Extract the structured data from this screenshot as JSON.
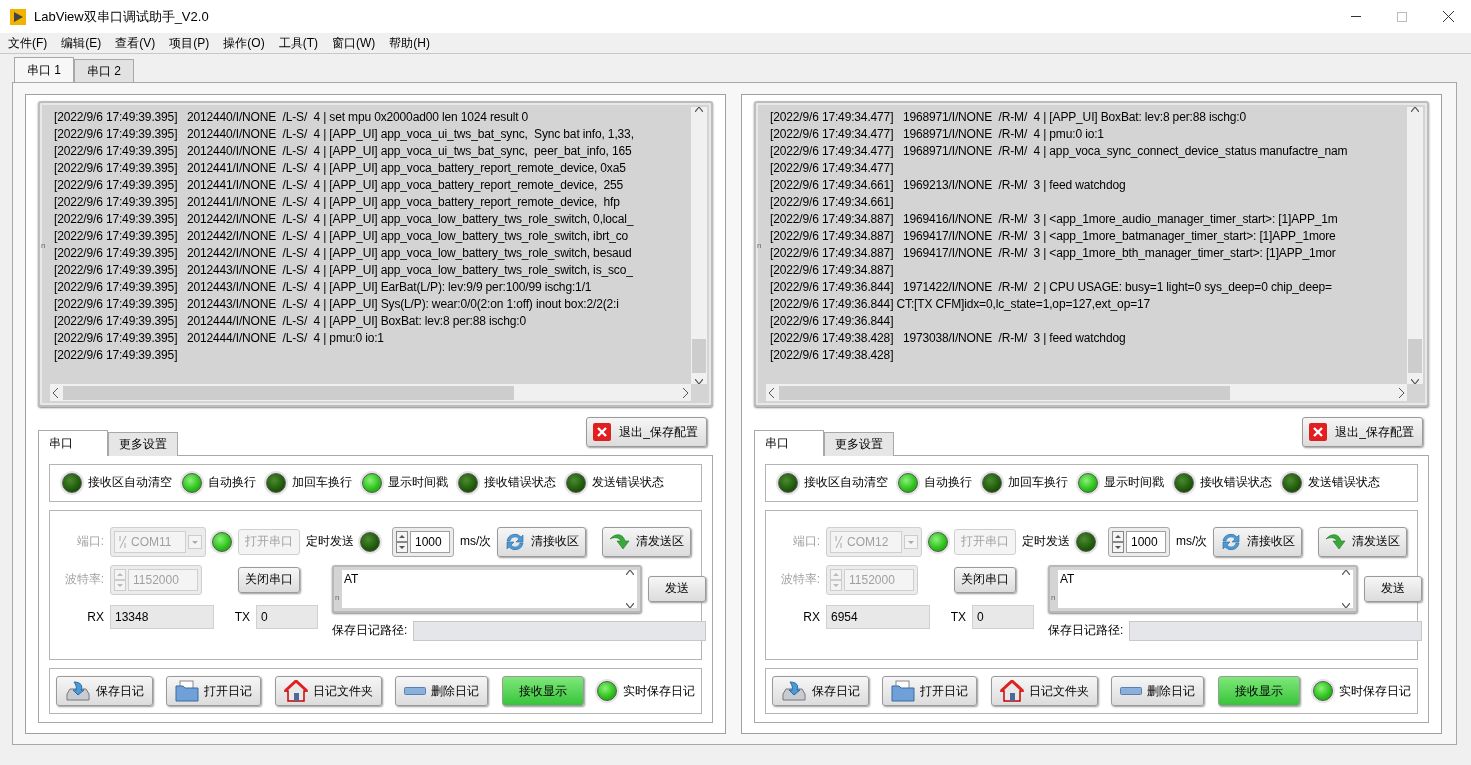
{
  "window": {
    "title": "LabView双串口调试助手_V2.0"
  },
  "menu": [
    "文件(F)",
    "编辑(E)",
    "查看(V)",
    "项目(P)",
    "操作(O)",
    "工具(T)",
    "窗口(W)",
    "帮助(H)"
  ],
  "tabs": [
    {
      "label": "串口 1",
      "selected": true
    },
    {
      "label": "串口 2",
      "selected": false
    }
  ],
  "panels": [
    {
      "log_marker": "n",
      "log": [
        "[2022/9/6 17:49:39.395]   2012440/I/NONE  /L-S/  4 | set mpu 0x2000ad00 len 1024 result 0",
        "[2022/9/6 17:49:39.395]   2012440/I/NONE  /L-S/  4 | [APP_UI] app_voca_ui_tws_bat_sync,  Sync bat info, 1,33,",
        "[2022/9/6 17:49:39.395]   2012440/I/NONE  /L-S/  4 | [APP_UI] app_voca_ui_tws_bat_sync,  peer_bat_info, 165",
        "[2022/9/6 17:49:39.395]   2012441/I/NONE  /L-S/  4 | [APP_UI] app_voca_battery_report_remote_device, 0xa5",
        "[2022/9/6 17:49:39.395]   2012441/I/NONE  /L-S/  4 | [APP_UI] app_voca_battery_report_remote_device,  255",
        "[2022/9/6 17:49:39.395]   2012441/I/NONE  /L-S/  4 | [APP_UI] app_voca_battery_report_remote_device,  hfp",
        "[2022/9/6 17:49:39.395]   2012442/I/NONE  /L-S/  4 | [APP_UI] app_voca_low_battery_tws_role_switch, 0,local_",
        "[2022/9/6 17:49:39.395]   2012442/I/NONE  /L-S/  4 | [APP_UI] app_voca_low_battery_tws_role_switch, ibrt_co",
        "[2022/9/6 17:49:39.395]   2012442/I/NONE  /L-S/  4 | [APP_UI] app_voca_low_battery_tws_role_switch, besaud",
        "[2022/9/6 17:49:39.395]   2012443/I/NONE  /L-S/  4 | [APP_UI] app_voca_low_battery_tws_role_switch, is_sco_",
        "[2022/9/6 17:49:39.395]   2012443/I/NONE  /L-S/  4 | [APP_UI] EarBat(L/P): lev:9/9 per:100/99 ischg:1/1",
        "[2022/9/6 17:49:39.395]   2012443/I/NONE  /L-S/  4 | [APP_UI] Sys(L/P): wear:0/0(2:on 1:off) inout box:2/2(2:i",
        "[2022/9/6 17:49:39.395]   2012444/I/NONE  /L-S/  4 | [APP_UI] BoxBat: lev:8 per:88 ischg:0",
        "[2022/9/6 17:49:39.395]   2012444/I/NONE  /L-S/  4 | pmu:0 io:1",
        "[2022/9/6 17:49:39.395]"
      ],
      "exit_button": "退出_保存配置",
      "config_tabs": [
        {
          "label": "串口",
          "selected": true
        },
        {
          "label": "更多设置",
          "selected": false
        }
      ],
      "indicators": [
        {
          "label": "接收区自动清空",
          "on": false
        },
        {
          "label": "自动换行",
          "on": true
        },
        {
          "label": "加回车换行",
          "on": false
        },
        {
          "label": "显示时间戳",
          "on": true
        },
        {
          "label": "接收错误状态",
          "on": false
        },
        {
          "label": "发送错误状态",
          "on": false
        }
      ],
      "port": {
        "label": "端口:",
        "value": "COM11",
        "disabled": true
      },
      "open_led": {
        "on": true
      },
      "open_button": {
        "label": "打开串口",
        "disabled": true
      },
      "timer": {
        "label": "定时发送",
        "on": false
      },
      "interval": {
        "value": "1000",
        "unit": "ms/次"
      },
      "clear_rx": "清接收区",
      "clear_tx": "清发送区",
      "baud": {
        "label": "波特率:",
        "value": "1152000",
        "disabled": true
      },
      "close_button": "关闭串口",
      "send_marker": "n",
      "send_text": "AT",
      "send_button": "发送",
      "rx": {
        "label": "RX",
        "value": "13348"
      },
      "tx": {
        "label": "TX",
        "value": "0"
      },
      "log_path": {
        "label": "保存日记路径:"
      },
      "actions": [
        {
          "label": "保存日记",
          "kind": "save"
        },
        {
          "label": "打开日记",
          "kind": "open"
        },
        {
          "label": "日记文件夹",
          "kind": "folder"
        },
        {
          "label": "删除日记",
          "kind": "delete"
        },
        {
          "label": "接收显示",
          "kind": "toggle",
          "on": true
        }
      ],
      "realtime": {
        "label": "实时保存日记",
        "on": true
      }
    },
    {
      "log_marker": "n",
      "log": [
        "[2022/9/6 17:49:34.477]   1968971/I/NONE  /R-M/  4 | [APP_UI] BoxBat: lev:8 per:88 ischg:0",
        "[2022/9/6 17:49:34.477]   1968971/I/NONE  /R-M/  4 | pmu:0 io:1",
        "[2022/9/6 17:49:34.477]   1968971/I/NONE  /R-M/  4 | app_voca_sync_connect_device_status manufactre_nam",
        "[2022/9/6 17:49:34.477]",
        "[2022/9/6 17:49:34.661]   1969213/I/NONE  /R-M/  3 | feed watchdog",
        "[2022/9/6 17:49:34.661]",
        "[2022/9/6 17:49:34.887]   1969416/I/NONE  /R-M/  3 | <app_1more_audio_manager_timer_start>: [1]APP_1m",
        "[2022/9/6 17:49:34.887]   1969417/I/NONE  /R-M/  3 | <app_1more_batmanager_timer_start>: [1]APP_1more",
        "[2022/9/6 17:49:34.887]   1969417/I/NONE  /R-M/  3 | <app_1more_bth_manager_timer_start>: [1]APP_1mor",
        "[2022/9/6 17:49:34.887]",
        "[2022/9/6 17:49:36.844]   1971422/I/NONE  /R-M/  2 | CPU USAGE: busy=1 light=0 sys_deep=0 chip_deep=",
        "[2022/9/6 17:49:36.844] CT:[TX CFM]idx=0,lc_state=1,op=127,ext_op=17",
        "[2022/9/6 17:49:36.844]",
        "[2022/9/6 17:49:38.428]   1973038/I/NONE  /R-M/  3 | feed watchdog",
        "[2022/9/6 17:49:38.428]"
      ],
      "exit_button": "退出_保存配置",
      "config_tabs": [
        {
          "label": "串口",
          "selected": true
        },
        {
          "label": "更多设置",
          "selected": false
        }
      ],
      "indicators": [
        {
          "label": "接收区自动清空",
          "on": false
        },
        {
          "label": "自动换行",
          "on": true
        },
        {
          "label": "加回车换行",
          "on": false
        },
        {
          "label": "显示时间戳",
          "on": true
        },
        {
          "label": "接收错误状态",
          "on": false
        },
        {
          "label": "发送错误状态",
          "on": false
        }
      ],
      "port": {
        "label": "端口:",
        "value": "COM12",
        "disabled": true
      },
      "open_led": {
        "on": true
      },
      "open_button": {
        "label": "打开串口",
        "disabled": true
      },
      "timer": {
        "label": "定时发送",
        "on": false
      },
      "interval": {
        "value": "1000",
        "unit": "ms/次"
      },
      "clear_rx": "清接收区",
      "clear_tx": "清发送区",
      "baud": {
        "label": "波特率:",
        "value": "1152000",
        "disabled": true
      },
      "close_button": "关闭串口",
      "send_marker": "n",
      "send_text": "AT",
      "send_button": "发送",
      "rx": {
        "label": "RX",
        "value": "6954"
      },
      "tx": {
        "label": "TX",
        "value": "0"
      },
      "log_path": {
        "label": "保存日记路径:"
      },
      "actions": [
        {
          "label": "保存日记",
          "kind": "save"
        },
        {
          "label": "打开日记",
          "kind": "open"
        },
        {
          "label": "日记文件夹",
          "kind": "folder"
        },
        {
          "label": "删除日记",
          "kind": "delete"
        },
        {
          "label": "接收显示",
          "kind": "toggle",
          "on": true
        }
      ],
      "realtime": {
        "label": "实时保存日记",
        "on": true
      }
    }
  ]
}
